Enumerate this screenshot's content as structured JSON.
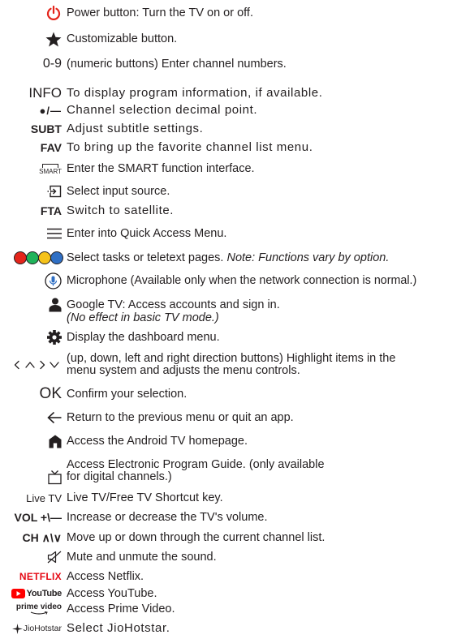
{
  "items": [
    {
      "icon": "power-icon",
      "icon_text": "",
      "text": "Power button: Turn the TV on or off."
    },
    {
      "icon": "star-icon",
      "icon_text": "",
      "text": "Customizable button."
    },
    {
      "icon": "numeric-icon",
      "icon_text": "0-9",
      "text": "(numeric buttons) Enter channel numbers."
    },
    {
      "icon": "info-icon",
      "icon_text": "INFO",
      "text": "To display program information, if available."
    },
    {
      "icon": "dot-dash-icon",
      "icon_text": "●/—",
      "text": "Channel selection decimal point."
    },
    {
      "icon": "subt-icon",
      "icon_text": "SUBT",
      "text": "Adjust subtitle settings."
    },
    {
      "icon": "fav-icon",
      "icon_text": "FAV",
      "text": "To bring up the favorite channel list menu."
    },
    {
      "icon": "smart-icon",
      "icon_text": "SMART",
      "text": "Enter the SMART function interface."
    },
    {
      "icon": "input-source-icon",
      "icon_text": "",
      "text": "Select input source."
    },
    {
      "icon": "fta-icon",
      "icon_text": "FTA",
      "text": "Switch to satellite."
    },
    {
      "icon": "menu-icon",
      "icon_text": "",
      "text": "Enter into Quick Access Menu."
    },
    {
      "icon": "color-buttons-icon",
      "icon_text": "",
      "text": "Select tasks or teletext pages.",
      "note": "Note: Functions vary by option."
    },
    {
      "icon": "microphone-icon",
      "icon_text": "",
      "text": "Microphone (Available only when the network connection is normal.)"
    },
    {
      "icon": "user-icon",
      "icon_text": "",
      "text": "Google TV: Access accounts and sign in.",
      "note": "(No effect in basic TV mode.)"
    },
    {
      "icon": "gear-icon",
      "icon_text": "",
      "text": "Display the dashboard menu."
    },
    {
      "icon": "direction-icon",
      "icon_text": "‹ ∧ › ∨",
      "text": "(up, down, left and right direction buttons) Highlight items in the",
      "text2": "menu system and adjusts the menu controls."
    },
    {
      "icon": "ok-icon",
      "icon_text": "OK",
      "text": "Confirm your selection."
    },
    {
      "icon": "back-icon",
      "icon_text": "",
      "text": "Return to the previous menu or quit an app."
    },
    {
      "icon": "home-icon",
      "icon_text": "",
      "text": "Access the Android TV homepage."
    },
    {
      "icon": "epg-icon",
      "icon_text": "",
      "text": "Access Electronic Program Guide. (only available",
      "text2": "for digital channels.)"
    },
    {
      "icon": "livetv-icon",
      "icon_text": "Live TV",
      "text": "Live TV/Free TV Shortcut key."
    },
    {
      "icon": "volume-icon",
      "icon_text": "VOL +\\—",
      "text": "Increase or decrease the TV's volume."
    },
    {
      "icon": "channel-icon",
      "icon_text": "CH ∧\\∨",
      "text": "Move up or down through the current channel list."
    },
    {
      "icon": "mute-icon",
      "icon_text": "",
      "text": "Mute and unmute the sound."
    },
    {
      "icon": "netflix-icon",
      "icon_text": "NETFLIX",
      "text": "Access Netflix."
    },
    {
      "icon": "youtube-icon",
      "icon_text": "YouTube",
      "text": "Access YouTube."
    },
    {
      "icon": "prime-video-icon",
      "icon_text": "prime video",
      "text": "Access Prime Video."
    },
    {
      "icon": "jiohotstar-icon",
      "icon_text": "JioHotstar",
      "text": "Select JioHotstar."
    }
  ],
  "colors": {
    "power": "#e4251b",
    "netflix": "#e50914",
    "youtube": "#ff0000",
    "text": "#231f20",
    "red_btn": "#e4251b",
    "green_btn": "#1fb35a",
    "yellow_btn": "#f5c21a",
    "blue_btn": "#2f6fc4",
    "mic": "#2f6fc4"
  }
}
